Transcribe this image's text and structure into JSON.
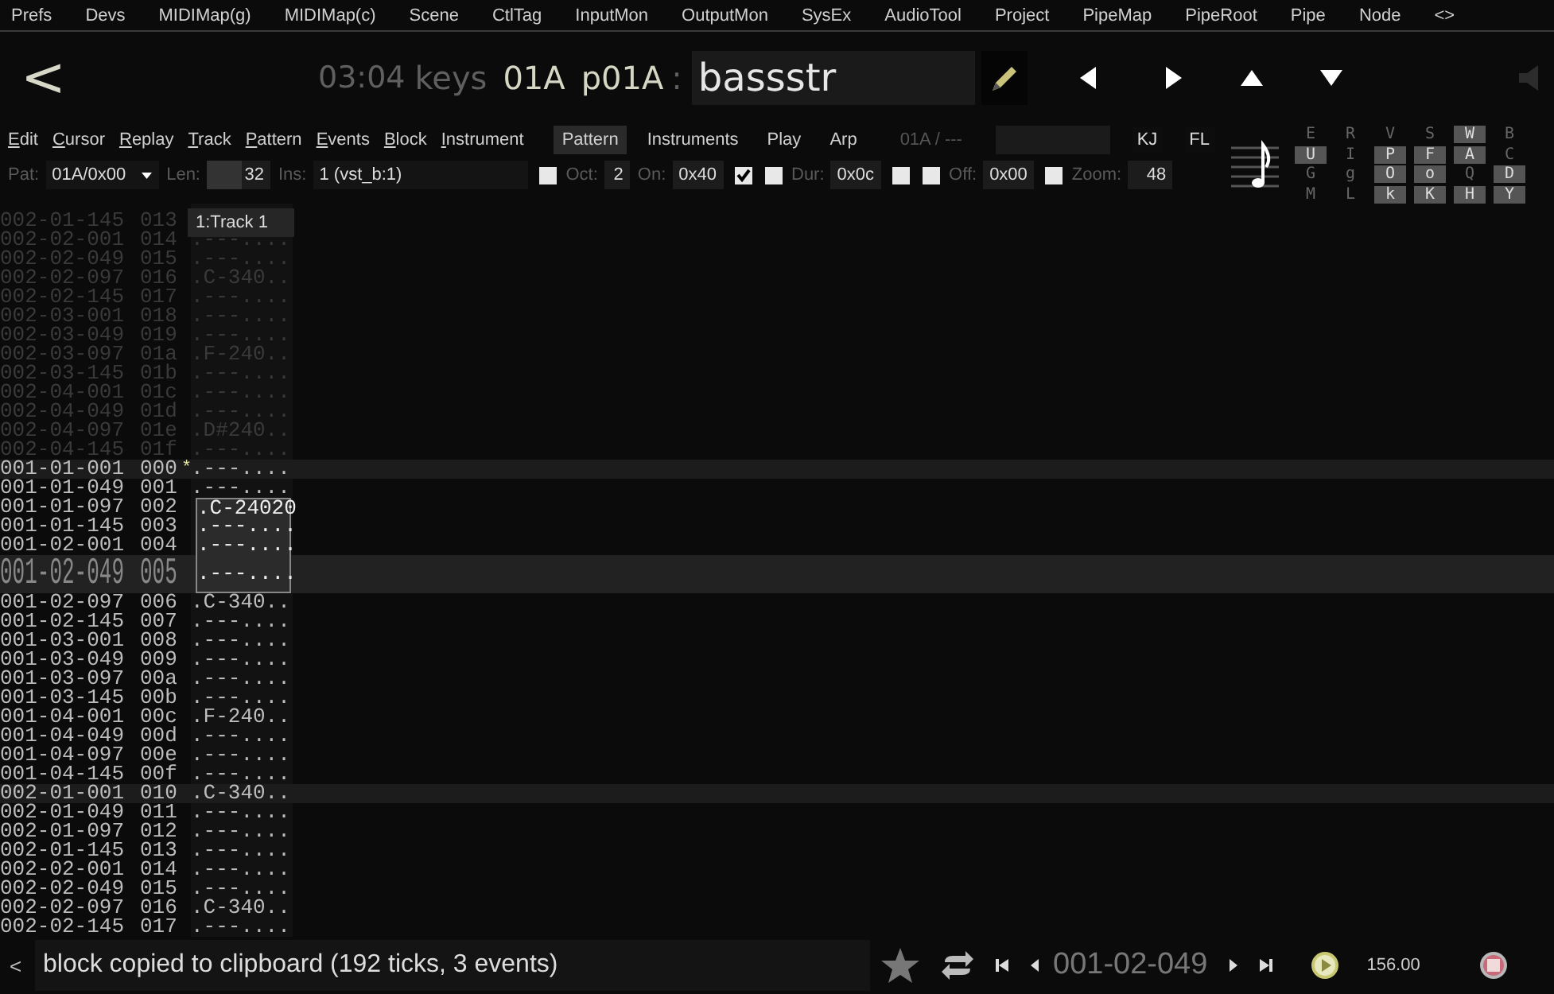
{
  "menu": [
    "Prefs",
    "Devs",
    "MIDIMap(g)",
    "MIDIMap(c)",
    "Scene",
    "CtlTag",
    "InputMon",
    "OutputMon",
    "SysEx",
    "AudioTool",
    "Project",
    "PipeMap",
    "PipeRoot",
    "Pipe",
    "Node",
    "<>"
  ],
  "header": {
    "back": "<",
    "time": "03:04",
    "mode": "keys",
    "pattern": "01A",
    "pattern_id": "p01A",
    "separator": ":",
    "name": "bassstr"
  },
  "edit_menu": [
    "Edit",
    "Cursor",
    "Replay",
    "Track",
    "Pattern",
    "Events",
    "Block",
    "Instrument"
  ],
  "tabs": [
    {
      "label": "Pattern",
      "selected": true
    },
    {
      "label": "Instruments",
      "selected": false
    },
    {
      "label": "Play",
      "selected": false
    },
    {
      "label": "Arp",
      "selected": false
    }
  ],
  "pattern_path": "01A / ---",
  "quick_buttons": [
    "KJ",
    "FL"
  ],
  "params": [
    {
      "kind": "label",
      "text": "Pat:"
    },
    {
      "kind": "dropdown",
      "value": "01A/0x00"
    },
    {
      "kind": "label",
      "text": "Len:"
    },
    {
      "kind": "split",
      "value": "32"
    },
    {
      "kind": "label",
      "text": "Ins:"
    },
    {
      "kind": "wide",
      "value": "1 (vst_b:1)"
    },
    {
      "kind": "checkbox",
      "checked": false
    },
    {
      "kind": "label",
      "text": "Oct:"
    },
    {
      "kind": "tiny",
      "value": "2"
    },
    {
      "kind": "label",
      "text": "On:"
    },
    {
      "kind": "field",
      "value": "0x40"
    },
    {
      "kind": "checkbox",
      "checked": true
    },
    {
      "kind": "checkbox",
      "checked": false
    },
    {
      "kind": "label",
      "text": "Dur:"
    },
    {
      "kind": "field",
      "value": "0x0c"
    },
    {
      "kind": "checkbox",
      "checked": false
    },
    {
      "kind": "checkbox",
      "checked": false
    },
    {
      "kind": "label",
      "text": "Off:"
    },
    {
      "kind": "field",
      "value": "0x00"
    },
    {
      "kind": "checkbox",
      "checked": false
    },
    {
      "kind": "label",
      "text": "Zoom:"
    },
    {
      "kind": "field",
      "value": "48"
    }
  ],
  "key_grid": [
    [
      {
        "label": "E",
        "on": false
      },
      {
        "label": "R",
        "on": false
      },
      {
        "label": "V",
        "on": false
      },
      {
        "label": "S",
        "on": false
      },
      {
        "label": "W",
        "on": true
      },
      {
        "label": "B",
        "on": false
      }
    ],
    [
      {
        "label": "U",
        "on": true
      },
      {
        "label": "I",
        "on": false
      },
      {
        "label": "P",
        "on": true
      },
      {
        "label": "F",
        "on": true
      },
      {
        "label": "A",
        "on": true
      },
      {
        "label": "C",
        "on": false
      }
    ],
    [
      {
        "label": "G",
        "on": false
      },
      {
        "label": "g",
        "on": false
      },
      {
        "label": "O",
        "on": true
      },
      {
        "label": "o",
        "on": true
      },
      {
        "label": "Q",
        "on": false
      },
      {
        "label": "D",
        "on": true
      }
    ],
    [
      {
        "label": "M",
        "on": false
      },
      {
        "label": "L",
        "on": false
      },
      {
        "label": "k",
        "on": true
      },
      {
        "label": "K",
        "on": true
      },
      {
        "label": "H",
        "on": true
      },
      {
        "label": "Y",
        "on": true
      }
    ]
  ],
  "track": {
    "header": "1:Track 1"
  },
  "rows": [
    {
      "pos": "002-01-145",
      "line": "013",
      "faded": true,
      "beat": false,
      "cursor": false,
      "in_block": false
    },
    {
      "pos": "002-02-001",
      "line": "014",
      "note": ".---....",
      "faded": true,
      "beat": false,
      "cursor": false,
      "in_block": false
    },
    {
      "pos": "002-02-049",
      "line": "015",
      "note": ".---....",
      "faded": true,
      "beat": false,
      "cursor": false,
      "in_block": false
    },
    {
      "pos": "002-02-097",
      "line": "016",
      "note": ".C-340..",
      "faded": true,
      "beat": false,
      "cursor": false,
      "in_block": false
    },
    {
      "pos": "002-02-145",
      "line": "017",
      "note": ".---....",
      "faded": true,
      "beat": false,
      "cursor": false,
      "in_block": false
    },
    {
      "pos": "002-03-001",
      "line": "018",
      "note": ".---....",
      "faded": true,
      "beat": false,
      "cursor": false,
      "in_block": false
    },
    {
      "pos": "002-03-049",
      "line": "019",
      "note": ".---....",
      "faded": true,
      "beat": false,
      "cursor": false,
      "in_block": false
    },
    {
      "pos": "002-03-097",
      "line": "01a",
      "note": ".F-240..",
      "faded": true,
      "beat": false,
      "cursor": false,
      "in_block": false
    },
    {
      "pos": "002-03-145",
      "line": "01b",
      "note": ".---....",
      "faded": true,
      "beat": false,
      "cursor": false,
      "in_block": false
    },
    {
      "pos": "002-04-001",
      "line": "01c",
      "note": ".---....",
      "faded": true,
      "beat": false,
      "cursor": false,
      "in_block": false
    },
    {
      "pos": "002-04-049",
      "line": "01d",
      "note": ".---....",
      "faded": true,
      "beat": false,
      "cursor": false,
      "in_block": false
    },
    {
      "pos": "002-04-097",
      "line": "01e",
      "note": ".D#240..",
      "faded": true,
      "beat": false,
      "cursor": false,
      "in_block": false
    },
    {
      "pos": "002-04-145",
      "line": "01f",
      "note": ".---....",
      "faded": true,
      "beat": false,
      "cursor": false,
      "in_block": false
    },
    {
      "pos": "001-01-001",
      "line": "000",
      "marker": "*",
      "note": ".---....",
      "faded": false,
      "beat": true,
      "cursor": false,
      "in_block": false
    },
    {
      "pos": "001-01-049",
      "line": "001",
      "note": ".---....",
      "faded": false,
      "beat": false,
      "cursor": false,
      "in_block": false
    },
    {
      "pos": "001-01-097",
      "line": "002",
      "note": ".C-24020",
      "faded": false,
      "beat": false,
      "cursor": false,
      "in_block": true
    },
    {
      "pos": "001-01-145",
      "line": "003",
      "note": ".---....",
      "faded": false,
      "beat": false,
      "cursor": false,
      "in_block": true
    },
    {
      "pos": "001-02-001",
      "line": "004",
      "note": ".---....",
      "faded": false,
      "beat": false,
      "cursor": false,
      "in_block": true
    },
    {
      "pos": "001-02-049",
      "line": "005",
      "note": ".---....",
      "faded": false,
      "beat": false,
      "cursor": true,
      "in_block": true
    },
    {
      "pos": "001-02-097",
      "line": "006",
      "note": ".C-340..",
      "faded": false,
      "beat": false,
      "cursor": false,
      "in_block": false
    },
    {
      "pos": "001-02-145",
      "line": "007",
      "note": ".---....",
      "faded": false,
      "beat": false,
      "cursor": false,
      "in_block": false
    },
    {
      "pos": "001-03-001",
      "line": "008",
      "note": ".---....",
      "faded": false,
      "beat": false,
      "cursor": false,
      "in_block": false
    },
    {
      "pos": "001-03-049",
      "line": "009",
      "note": ".---....",
      "faded": false,
      "beat": false,
      "cursor": false,
      "in_block": false
    },
    {
      "pos": "001-03-097",
      "line": "00a",
      "note": ".---....",
      "faded": false,
      "beat": false,
      "cursor": false,
      "in_block": false
    },
    {
      "pos": "001-03-145",
      "line": "00b",
      "note": ".---....",
      "faded": false,
      "beat": false,
      "cursor": false,
      "in_block": false
    },
    {
      "pos": "001-04-001",
      "line": "00c",
      "note": ".F-240..",
      "faded": false,
      "beat": false,
      "cursor": false,
      "in_block": false
    },
    {
      "pos": "001-04-049",
      "line": "00d",
      "note": ".---....",
      "faded": false,
      "beat": false,
      "cursor": false,
      "in_block": false
    },
    {
      "pos": "001-04-097",
      "line": "00e",
      "note": ".---....",
      "faded": false,
      "beat": false,
      "cursor": false,
      "in_block": false
    },
    {
      "pos": "001-04-145",
      "line": "00f",
      "note": ".---....",
      "faded": false,
      "beat": false,
      "cursor": false,
      "in_block": false
    },
    {
      "pos": "002-01-001",
      "line": "010",
      "note": ".C-340..",
      "faded": false,
      "beat": true,
      "cursor": false,
      "in_block": false
    },
    {
      "pos": "002-01-049",
      "line": "011",
      "note": ".---....",
      "faded": false,
      "beat": false,
      "cursor": false,
      "in_block": false
    },
    {
      "pos": "002-01-097",
      "line": "012",
      "note": ".---....",
      "faded": false,
      "beat": false,
      "cursor": false,
      "in_block": false
    },
    {
      "pos": "002-01-145",
      "line": "013",
      "note": ".---....",
      "faded": false,
      "beat": false,
      "cursor": false,
      "in_block": false
    },
    {
      "pos": "002-02-001",
      "line": "014",
      "note": ".---....",
      "faded": false,
      "beat": false,
      "cursor": false,
      "in_block": false
    },
    {
      "pos": "002-02-049",
      "line": "015",
      "note": ".---....",
      "faded": false,
      "beat": false,
      "cursor": false,
      "in_block": false
    },
    {
      "pos": "002-02-097",
      "line": "016",
      "note": ".C-340..",
      "faded": false,
      "beat": false,
      "cursor": false,
      "in_block": false
    },
    {
      "pos": "002-02-145",
      "line": "017",
      "note": ".---....",
      "faded": false,
      "beat": false,
      "cursor": false,
      "in_block": false
    }
  ],
  "status": {
    "back": "<",
    "message": "block copied to clipboard (192 ticks, 3 events)",
    "position": "001-02-049",
    "tempo": "156.00"
  }
}
